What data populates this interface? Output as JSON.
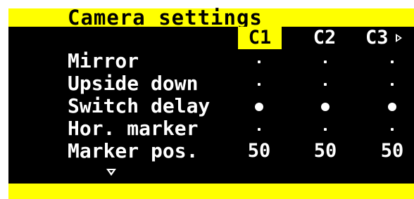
{
  "title": "Camera settings",
  "columns": [
    {
      "label": "C1",
      "selected": true
    },
    {
      "label": "C2",
      "selected": false
    },
    {
      "label": "C3",
      "selected": false
    }
  ],
  "rows": [
    {
      "label": "Mirror",
      "values": [
        "dot-small",
        "dot-small",
        "dot-small"
      ]
    },
    {
      "label": "Upside down",
      "values": [
        "dot-small",
        "dot-small",
        "dot-small"
      ]
    },
    {
      "label": "Switch delay",
      "values": [
        "dot-large",
        "dot-large",
        "dot-large"
      ]
    },
    {
      "label": "Hor. marker",
      "values": [
        "dot-small",
        "dot-small",
        "dot-small"
      ]
    },
    {
      "label": "Marker pos.",
      "values": [
        "50",
        "50",
        "50"
      ]
    }
  ],
  "icons": {
    "scroll_right": "triangle-right-icon",
    "scroll_down": "triangle-down-icon"
  },
  "colors": {
    "accent": "#ffff00",
    "background": "#000000",
    "text": "#ffffff"
  }
}
